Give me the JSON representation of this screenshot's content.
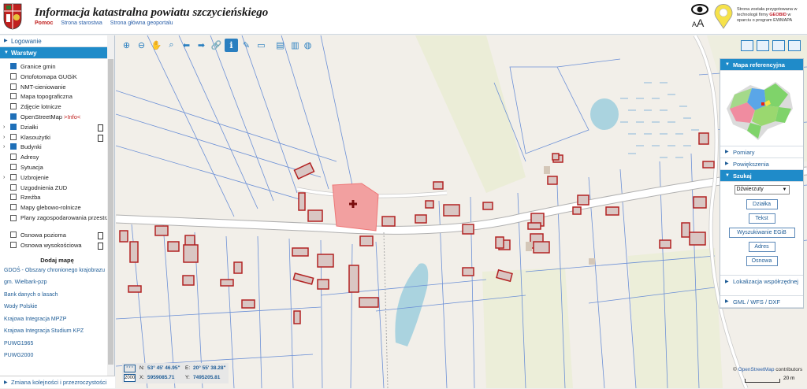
{
  "header": {
    "title": "Informacja katastralna powiatu szczycieńskiego",
    "links": [
      "Pomoc",
      "Strona starostwa",
      "Strona główna geoportalu"
    ],
    "font_size_label": "AA",
    "credit_pre": "Strona została przygotowana w technologii firmy ",
    "credit_brand": "GEOBID",
    "credit_post": " w oparciu o program EWMAPA"
  },
  "left_panel": {
    "login": "Logowanie",
    "layers_title": "Warstwy",
    "layers": [
      {
        "label": "Granice gmin",
        "checked": true,
        "expand": false,
        "doc": false
      },
      {
        "label": "Ortofotomapa GUGiK",
        "checked": false,
        "expand": false,
        "doc": false
      },
      {
        "label": "NMT-cieniowanie",
        "checked": false,
        "expand": false,
        "doc": false
      },
      {
        "label": "Mapa topograficzna",
        "checked": false,
        "expand": false,
        "doc": false
      },
      {
        "label": "Zdjęcie lotnicze",
        "checked": false,
        "expand": false,
        "doc": false
      },
      {
        "label": "OpenStreetMap",
        "extra": ">Info<",
        "checked": true,
        "expand": false,
        "doc": false
      },
      {
        "label": "Działki",
        "checked": true,
        "expand": true,
        "doc": true
      },
      {
        "label": "Klasoużytki",
        "checked": false,
        "expand": true,
        "doc": true
      },
      {
        "label": "Budynki",
        "checked": true,
        "expand": true,
        "doc": false
      },
      {
        "label": "Adresy",
        "checked": false,
        "expand": false,
        "doc": false
      },
      {
        "label": "Sytuacja",
        "checked": false,
        "expand": false,
        "doc": false
      },
      {
        "label": "Uzbrojenie",
        "checked": false,
        "expand": true,
        "doc": false
      },
      {
        "label": "Uzgodnienia ZUD",
        "checked": false,
        "expand": false,
        "doc": false
      },
      {
        "label": "Rzeźba",
        "checked": false,
        "expand": false,
        "doc": false
      },
      {
        "label": "Mapy glebowo-rolnicze",
        "checked": false,
        "expand": false,
        "doc": false
      },
      {
        "label": "Plany zagospodarowania przestrzennego",
        "checked": false,
        "expand": false,
        "doc": false,
        "two": true
      },
      {
        "label": "Osnowa pozioma",
        "checked": false,
        "expand": false,
        "doc": true
      },
      {
        "label": "Osnowa wysokościowa",
        "checked": false,
        "expand": false,
        "doc": true
      }
    ],
    "add_map": "Dodaj mapę",
    "map_links": [
      "GDOŚ - Obszary chronionego krajobrazu",
      "gm. Wielbark-pzp",
      "Bank danych o lasach",
      "Wody Polskie",
      "Krajowa Integracja MPZP",
      "Krajowa Integracja Studium KPZ",
      "PUWG1965",
      "PUWG2000"
    ],
    "order": "Zmiana kolejności i przezroczystości"
  },
  "toolbar": {
    "tools": [
      "zoom-in-icon",
      "zoom-out-icon",
      "pan-hand-icon",
      "zoom-box-icon",
      "back-arrow-icon",
      "forward-arrow-icon",
      "link-icon",
      "info-icon",
      "pen-icon",
      "measure-icon",
      "print-icon",
      "print-preview-icon",
      "globe-icon"
    ],
    "active": "info-icon"
  },
  "right_panel": {
    "ref_map": "Mapa referencyjna",
    "pomiary": "Pomiary",
    "powiekszenia": "Powiększenia",
    "szukaj": "Szukaj",
    "gmina_selected": "Dźwierzuty",
    "buttons": [
      "Działka",
      "Tekst",
      "Wyszukiwanie EGiB",
      "Adres",
      "Osnowa"
    ],
    "lokalizacja": "Lokalizacja współrzędnej",
    "gml": "GML / WFS / DXF"
  },
  "coords": {
    "scale_label": "* * *",
    "zoom_value": "2000",
    "n_label": "N:",
    "n_value": "53° 45' 46.95\"",
    "e_label": "E:",
    "e_value": "20° 55' 38.28\"",
    "x_label": "X:",
    "x_value": "5959085.71",
    "y_label": "Y:",
    "y_value": "7495205.81"
  },
  "attribution": {
    "prefix": "© ",
    "link": "OpenStreetMap",
    "suffix": " contributors"
  },
  "scalebar": "20 m",
  "colors": {
    "accent": "#1f8bc9",
    "parcel": "#b22222",
    "building_fill": "#d9c6c3",
    "selected": "#f2a0a0",
    "road": "#ffffff",
    "water": "#aad3df",
    "grass": "#e8edcf"
  }
}
